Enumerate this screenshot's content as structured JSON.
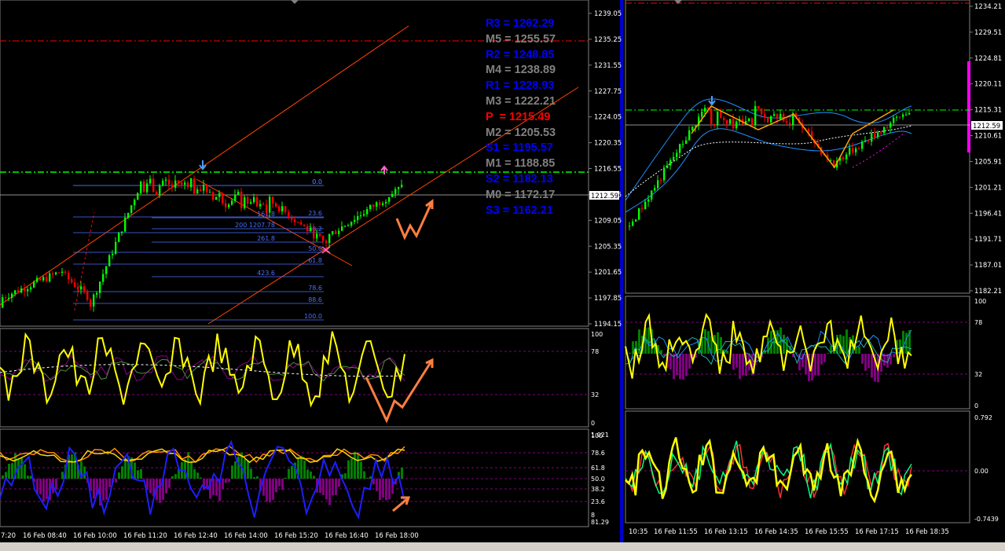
{
  "colors": {
    "background": "#000000",
    "grid": "#808080",
    "bull_candle": "#00ff00",
    "bear_candle": "#ff0000",
    "fib": "#4a6fff",
    "channel": "#ff4500",
    "pivot_blue": "#0000ff",
    "pivot_grey": "#808080",
    "pivot_red": "#ff0000",
    "oscillator_yellow": "#ffff00",
    "histogram_green": "#008000",
    "histogram_purple": "#800080",
    "accent_magenta": "#ff00ff",
    "arrow_orange": "#ff7f3f",
    "divider_blue": "#0000cc"
  },
  "left_chart": {
    "price_axis": [
      "1239.05",
      "1235.25",
      "1231.55",
      "1227.75",
      "1224.05",
      "1220.35",
      "1216.55",
      "1212.85",
      "1209.05",
      "1205.35",
      "1201.65",
      "1197.85",
      "1194.15"
    ],
    "current_price": "1212.59",
    "pivots": [
      {
        "text": "R3 = 1262.29",
        "color": "#0000ff"
      },
      {
        "text": "M5 = 1255.57",
        "color": "#808080"
      },
      {
        "text": "R2 = 1248.85",
        "color": "#0000ff"
      },
      {
        "text": "M4 = 1238.89",
        "color": "#808080"
      },
      {
        "text": "R1 = 1228.93",
        "color": "#0000ff"
      },
      {
        "text": "M3 = 1222.21",
        "color": "#808080"
      },
      {
        "text": "P  = 1215.49",
        "color": "#ff0000"
      },
      {
        "text": "M2 = 1205.53",
        "color": "#808080"
      },
      {
        "text": "S1 = 1195.57",
        "color": "#0000ff"
      },
      {
        "text": "M1 = 1188.85",
        "color": "#808080"
      },
      {
        "text": "S2 = 1182.13",
        "color": "#0000ff"
      },
      {
        "text": "M0 = 1172.17",
        "color": "#808080"
      },
      {
        "text": "S3 = 1162.21",
        "color": "#0000ff"
      }
    ],
    "fib_labels": [
      "0.0",
      "0.0",
      "23.6",
      "38.2",
      "50.0",
      "61.8",
      "78.6",
      "88.6",
      "100.0",
      "161.8",
      "200 1207.78",
      "261.8",
      "423.6"
    ],
    "osc1_axis": [
      "100",
      "78",
      "32",
      "0"
    ],
    "osc2_axis": [
      "100",
      "78.6",
      "61.8",
      "50.0",
      "38.2",
      "23.6",
      "8",
      "81.29"
    ],
    "osc2_top_label": "1.021",
    "time_axis": [
      "7:20",
      "16 Feb 08:40",
      "16 Feb 10:00",
      "16 Feb 11:20",
      "16 Feb 12:40",
      "16 Feb 14:00",
      "16 Feb 15:20",
      "16 Feb 16:40",
      "16 Feb 18:00"
    ]
  },
  "right_chart": {
    "price_axis": [
      "1234.21",
      "1229.51",
      "1224.81",
      "1220.11",
      "1215.31",
      "1210.61",
      "1205.91",
      "1201.21",
      "1196.41",
      "1191.71",
      "1187.01",
      "1182.21"
    ],
    "current_price": "1212.59",
    "osc1_axis": [
      "100",
      "78",
      "32",
      "0"
    ],
    "osc2_axis": [
      "0.792",
      "0.00",
      "-0.7439"
    ],
    "time_axis": [
      "10:35",
      "16 Feb 11:55",
      "16 Feb 13:15",
      "16 Feb 14:35",
      "16 Feb 15:55",
      "16 Feb 17:15",
      "16 Feb 18:35"
    ]
  }
}
